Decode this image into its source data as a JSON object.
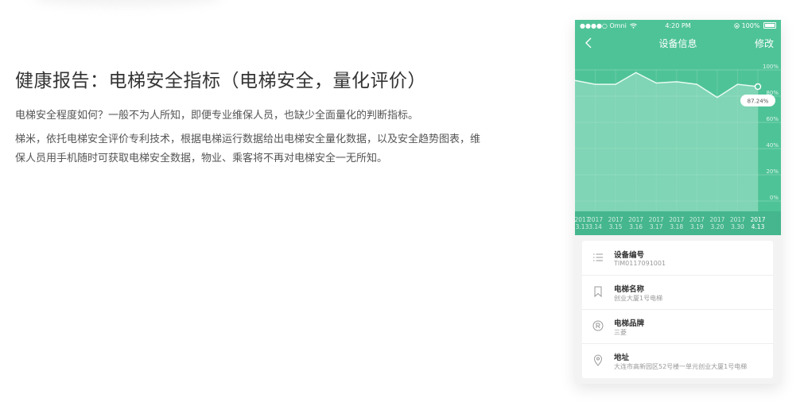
{
  "headline": "健康报告：电梯安全指标（电梯安全，量化评价）",
  "paragraph_1": "电梯安全程度如何？一般不为人所知，即便专业维保人员，也缺少全面量化的判断指标。",
  "paragraph_2": "梯米，依托电梯安全评价专利技术，根据电梯运行数据给出电梯安全量化数据，以及安全趋势图表，维保人员用手机随时可获取电梯安全数据，物业、乘客将不再对电梯安全一无所知。",
  "phone": {
    "status_bar": {
      "carrier": "●●●●○ Omni",
      "wifi_icon": "wifi-icon",
      "time": "4:20 PM",
      "battery_text": "100%",
      "lock_icon": "rotation-lock-icon"
    },
    "nav": {
      "title": "设备信息",
      "edit_label": "修改",
      "back_icon": "chevron-left-icon"
    },
    "info_rows": [
      {
        "icon": "list-icon",
        "label": "设备编号",
        "value": "TIM0117091001"
      },
      {
        "icon": "bookmark-icon",
        "label": "电梯名称",
        "value": "创业大厦1号电梯"
      },
      {
        "icon": "registered-icon",
        "label": "电梯品牌",
        "value": "三菱"
      },
      {
        "icon": "location-pin-icon",
        "label": "地址",
        "value": "大连市高新园区52号楼一单元创业大厦1号电梯"
      }
    ]
  },
  "chart_data": {
    "type": "area",
    "x": [
      "2017\n3.13",
      "2017\n3.14",
      "2017\n3.15",
      "2017\n3.16",
      "2017\n3.17",
      "2017\n3.18",
      "2017\n3.19",
      "2017\n3.20",
      "2017\n3.30",
      "2017\n4.13"
    ],
    "values": [
      92,
      89,
      89,
      98,
      90,
      91,
      89,
      79,
      89,
      87.24
    ],
    "ylim": [
      0,
      100
    ],
    "y_ticks": [
      "100%",
      "80%",
      "60%",
      "40%",
      "20%",
      "0%"
    ],
    "highlight_label": "87.24%",
    "highlight_index": 9,
    "grid": true,
    "colors": {
      "background": "#4fc398",
      "area": "#a8e4cd",
      "date_bar": "#45b68d"
    }
  }
}
